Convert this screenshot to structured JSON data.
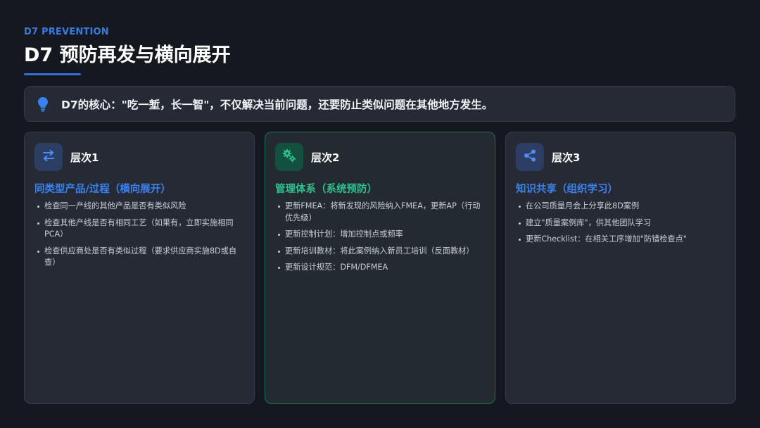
{
  "header": {
    "eyebrow": "D7 PREVENTION",
    "title": "D7 预防再发与横向展开"
  },
  "callout": {
    "icon": "lightbulb-icon",
    "text": "D7的核心：\"吃一堑，长一智\"，不仅解决当前问题，还要防止类似问题在其他地方发生。"
  },
  "cards": [
    {
      "icon": "swap-arrows-icon",
      "level": "层次1",
      "subtitle": "同类型产品/过程（横向展开）",
      "accent": "#3b82f0",
      "items": [
        "检查同一产线的其他产品是否有类似风险",
        "检查其他产线是否有相同工艺（如果有，立即实施相同PCA）",
        "检查供应商处是否有类似过程（要求供应商实施8D或自查）"
      ]
    },
    {
      "icon": "gears-icon",
      "level": "层次2",
      "subtitle": "管理体系（系统预防）",
      "accent": "#2fc08e",
      "items": [
        "更新FMEA：将新发现的风险纳入FMEA，更新AP（行动优先级）",
        "更新控制计划：增加控制点或频率",
        "更新培训教材：将此案例纳入新员工培训（反面教材）",
        "更新设计规范：DFM/DFMEA"
      ]
    },
    {
      "icon": "share-icon",
      "level": "层次3",
      "subtitle": "知识共享（组织学习）",
      "accent": "#3b82f0",
      "items": [
        "在公司质量月会上分享此8D案例",
        "建立\"质量案例库\"，供其他团队学习",
        "更新Checklist：在相关工序增加\"防错检查点\""
      ]
    }
  ]
}
